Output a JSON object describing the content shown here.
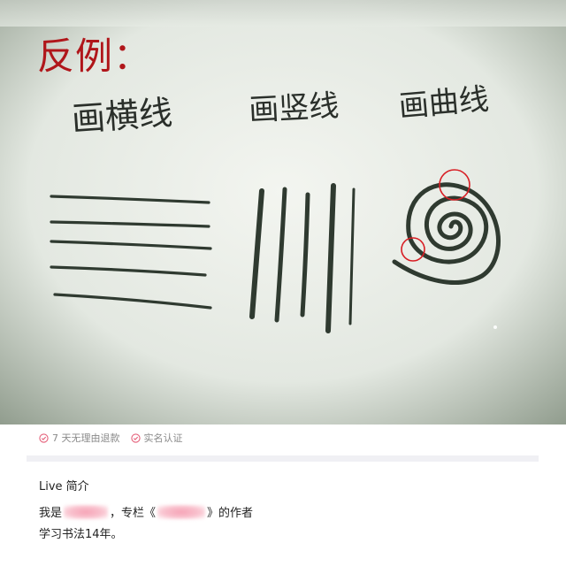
{
  "photo": {
    "counter_label": "反例：",
    "handwriting": {
      "horizontal": "画横线",
      "vertical": "画竖线",
      "curve": "画曲线"
    }
  },
  "guarantees": [
    {
      "label": "7 天无理由退款",
      "icon": "check-circle-icon"
    },
    {
      "label": "实名认证",
      "icon": "check-circle-icon"
    }
  ],
  "intro": {
    "title": "Live 简介",
    "line1_prefix": "我是",
    "line1_middle": "，专栏《",
    "line1_suffix": "》的作者",
    "line2": "学习书法14年。"
  },
  "colors": {
    "accent_red": "#b0161a",
    "check_pink": "#e5607a",
    "ink": "#2f3a30"
  }
}
